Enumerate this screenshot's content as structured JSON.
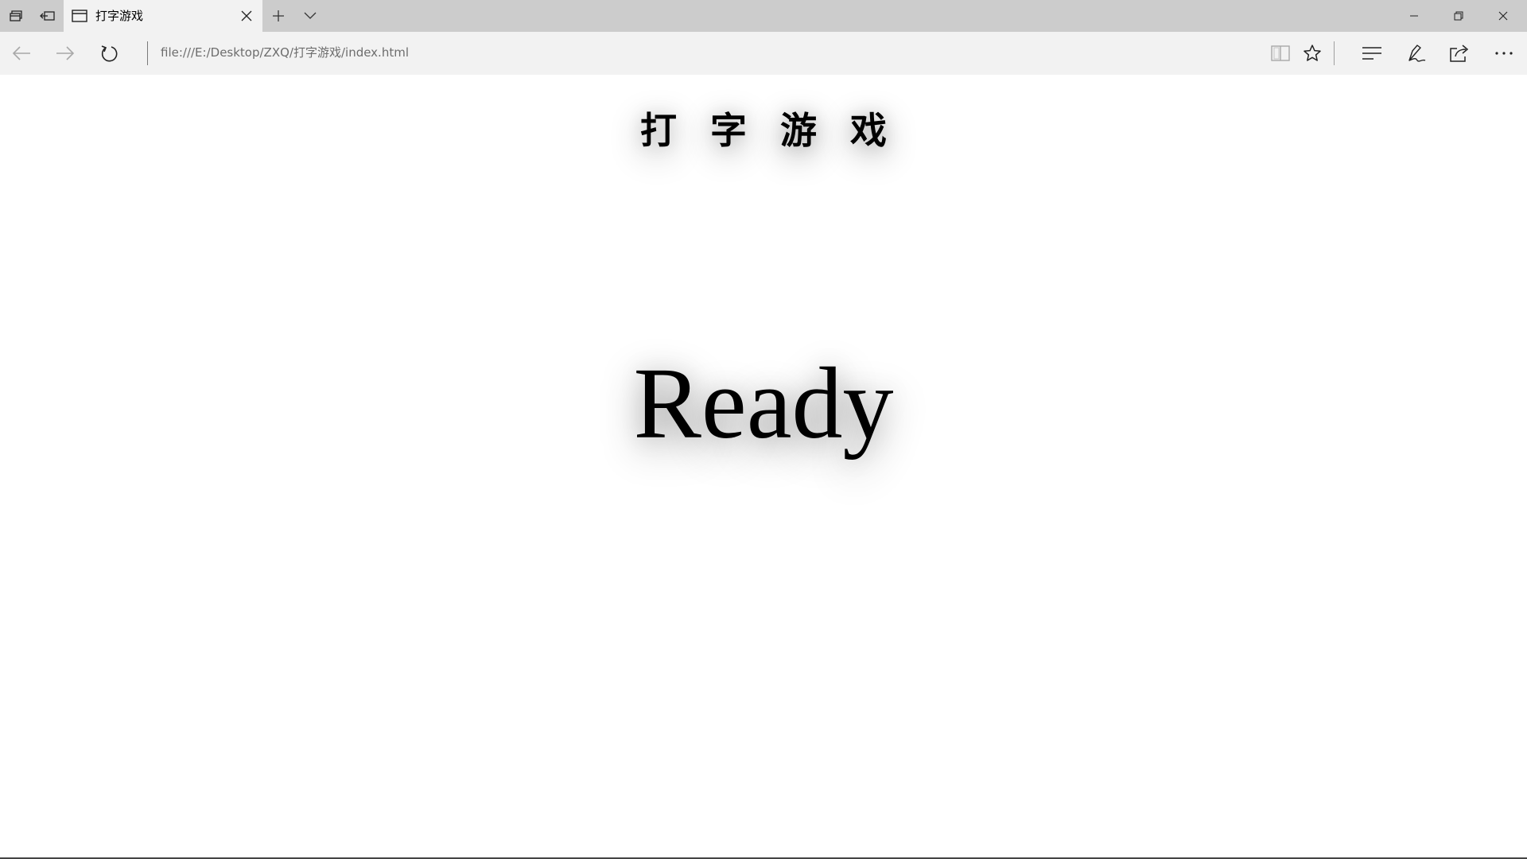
{
  "tab": {
    "title": "打字游戏"
  },
  "address_bar": {
    "url": "file:///E:/Desktop/ZXQ/打字游戏/index.html"
  },
  "page": {
    "heading": "打字游戏",
    "status": "Ready"
  },
  "icons": {
    "tab_strip": [
      "set-aside-tabs-icon",
      "restore-tabs-icon",
      "page-icon",
      "close-icon",
      "plus-icon",
      "chevron-down-icon"
    ],
    "window_controls": [
      "minimize-icon",
      "restore-icon",
      "close-icon"
    ],
    "navigation": [
      "back-arrow-icon",
      "forward-arrow-icon",
      "refresh-icon"
    ],
    "toolbar": [
      "reading-view-icon",
      "star-icon",
      "hub-icon",
      "pen-icon",
      "share-icon",
      "more-icon"
    ]
  },
  "colors": {
    "tab_strip_bg": "#cccccc",
    "active_tab_bg": "#f2f2f2",
    "address_text": "#6d6d6d",
    "page_bg": "#ffffff"
  }
}
